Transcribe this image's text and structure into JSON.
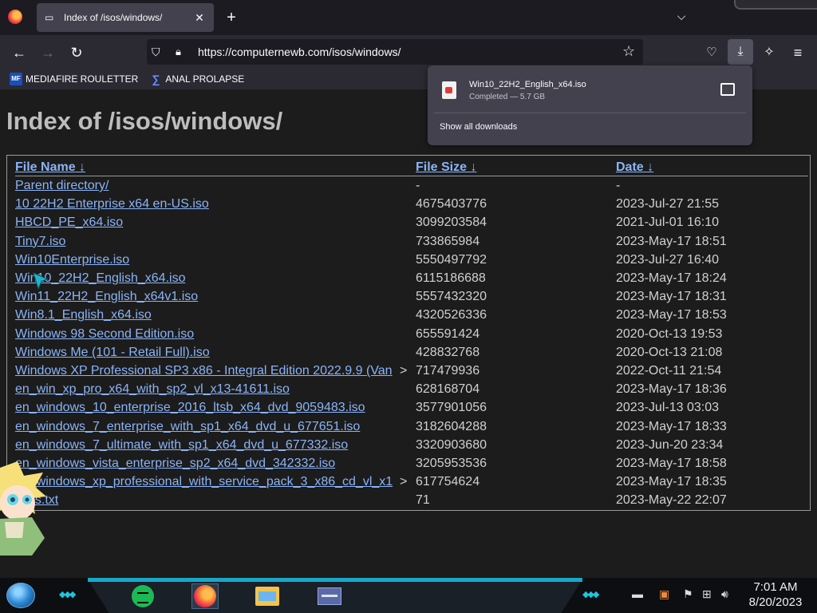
{
  "browser": {
    "tab": {
      "title": "Index of /isos/windows/",
      "favicon": "folder-tab-icon",
      "close": "✕"
    },
    "new_tab": "+",
    "tab_list": "⌵",
    "url": "https://computernewb.com/isos/windows/",
    "bookmarks": [
      {
        "label": "MEDIAFIRE ROULETTER",
        "icon_text": "MF T"
      },
      {
        "label": "ANAL PROLAPSE",
        "icon_text": "∑"
      }
    ]
  },
  "downloads_panel": {
    "file_name": "Win10_22H2_English_x64.iso",
    "status": "Completed — 5.7 GB",
    "show_all": "Show all downloads"
  },
  "page": {
    "heading": "Index of /isos/windows/",
    "columns": {
      "name": "File Name",
      "size": "File Size",
      "date": "Date",
      "sort_arrow": "↓"
    },
    "rows": [
      {
        "name": "Parent directory/",
        "size": "-",
        "date": "-"
      },
      {
        "name": "10 22H2 Enterprise x64 en-US.iso",
        "size": "4675403776",
        "date": "2023-Jul-27 21:55"
      },
      {
        "name": "HBCD_PE_x64.iso",
        "size": "3099203584",
        "date": "2021-Jul-01 16:10"
      },
      {
        "name": "Tiny7.iso",
        "size": "733865984",
        "date": "2023-May-17 18:51"
      },
      {
        "name": "Win10Enterprise.iso",
        "size": "5550497792",
        "date": "2023-Jul-27 16:40"
      },
      {
        "name": "Win10_22H2_English_x64.iso",
        "size": "6115186688",
        "date": "2023-May-17 18:24"
      },
      {
        "name": "Win11_22H2_English_x64v1.iso",
        "size": "5557432320",
        "date": "2023-May-17 18:31"
      },
      {
        "name": "Win8.1_English_x64.iso",
        "size": "4320526336",
        "date": "2023-May-17 18:53"
      },
      {
        "name": "Windows 98 Second Edition.iso",
        "size": "655591424",
        "date": "2020-Oct-13 19:53"
      },
      {
        "name": "Windows Me (101 - Retail Full).iso",
        "size": "428832768",
        "date": "2020-Oct-13 21:08"
      },
      {
        "name": "Windows XP Professional SP3 x86 - Integral Edition 2022.9.9 (Van",
        "more": ">",
        "size": "717479936",
        "date": "2022-Oct-11 21:54"
      },
      {
        "name": "en_win_xp_pro_x64_with_sp2_vl_x13-41611.iso",
        "size": "628168704",
        "date": "2023-May-17 18:36"
      },
      {
        "name": "en_windows_10_enterprise_2016_ltsb_x64_dvd_9059483.iso",
        "size": "3577901056",
        "date": "2023-Jul-13 03:03"
      },
      {
        "name": "en_windows_7_enterprise_with_sp1_x64_dvd_u_677651.iso",
        "size": "3182604288",
        "date": "2023-May-17 18:33"
      },
      {
        "name": "en_windows_7_ultimate_with_sp1_x64_dvd_u_677332.iso",
        "size": "3320903680",
        "date": "2023-Jun-20 23:34"
      },
      {
        "name": "en_windows_vista_enterprise_sp2_x64_dvd_342332.iso",
        "size": "3205953536",
        "date": "2023-May-17 18:58"
      },
      {
        "name": "en_windows_xp_professional_with_service_pack_3_x86_cd_vl_x1",
        "more": ">",
        "size": "617754624",
        "date": "2023-May-17 18:35"
      },
      {
        "name": "keys.txt",
        "size": "71",
        "date": "2023-May-22 22:07"
      }
    ]
  },
  "taskbar": {
    "time": "7:01 AM",
    "date": "8/20/2023"
  },
  "colors": {
    "link": "#8ab4f8",
    "taskbar_accent": "#18a7c9"
  }
}
